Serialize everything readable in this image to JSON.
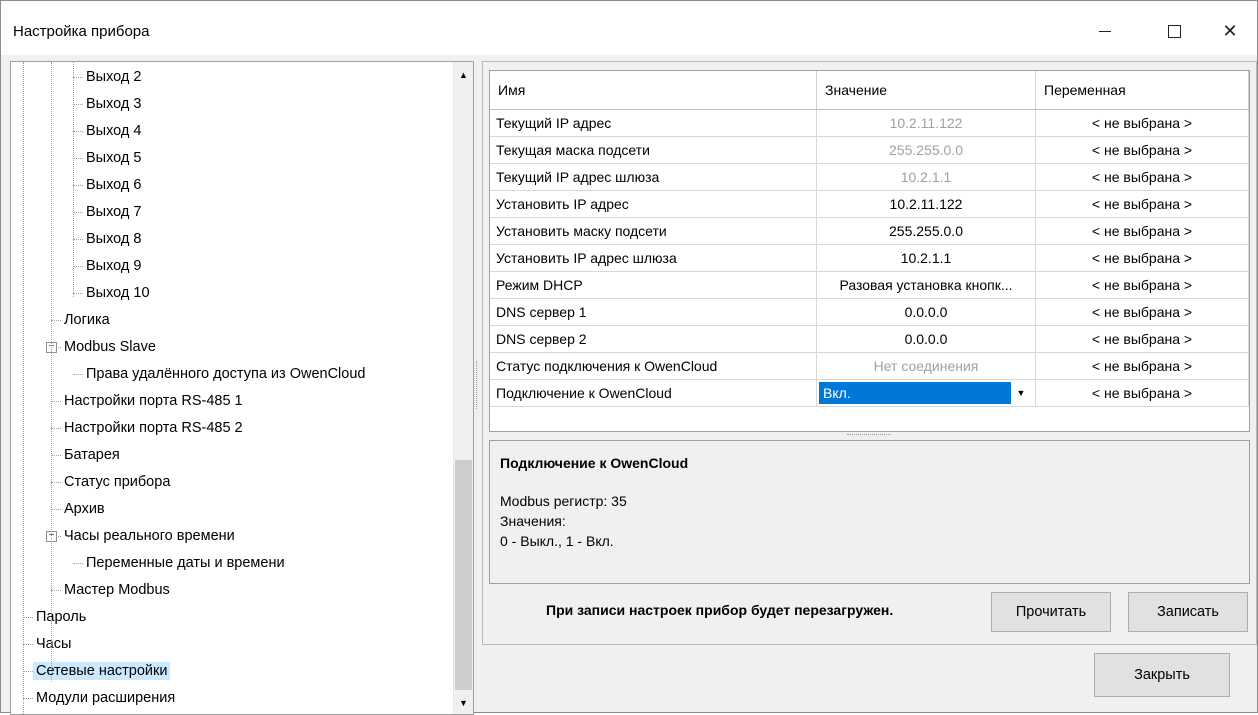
{
  "window": {
    "title": "Настройка прибора",
    "minimize_label": "—",
    "close_label": "✕"
  },
  "tree": {
    "items": [
      {
        "label": "Выход 2",
        "level": 3
      },
      {
        "label": "Выход 3",
        "level": 3
      },
      {
        "label": "Выход 4",
        "level": 3
      },
      {
        "label": "Выход 5",
        "level": 3
      },
      {
        "label": "Выход 6",
        "level": 3
      },
      {
        "label": "Выход 7",
        "level": 3
      },
      {
        "label": "Выход 8",
        "level": 3
      },
      {
        "label": "Выход 9",
        "level": 3
      },
      {
        "label": "Выход 10",
        "level": 3
      },
      {
        "label": "Логика",
        "level": 2
      },
      {
        "label": "Modbus Slave",
        "level": 2,
        "expander": "−"
      },
      {
        "label": "Права удалённого доступа из OwenCloud",
        "level": 3
      },
      {
        "label": "Настройки порта RS-485 1",
        "level": 2
      },
      {
        "label": "Настройки порта RS-485 2",
        "level": 2
      },
      {
        "label": "Батарея",
        "level": 2
      },
      {
        "label": "Статус прибора",
        "level": 2
      },
      {
        "label": "Архив",
        "level": 2
      },
      {
        "label": "Часы реального времени",
        "level": 2,
        "expander": "−"
      },
      {
        "label": "Переменные даты и времени",
        "level": 3
      },
      {
        "label": "Мастер Modbus",
        "level": 2
      },
      {
        "label": "Пароль",
        "level": 1
      },
      {
        "label": "Часы",
        "level": 1
      },
      {
        "label": "Сетевые настройки",
        "level": 1,
        "selected": true
      },
      {
        "label": "Модули расширения",
        "level": 1
      }
    ],
    "scroll_up": "▲",
    "scroll_down": "▼"
  },
  "grid": {
    "columns": [
      "Имя",
      "Значение",
      "Переменная"
    ],
    "rows": [
      {
        "name": "Текущий IP адрес",
        "value": "10.2.11.122",
        "readonly": true,
        "variable": "< не выбрана >"
      },
      {
        "name": "Текущая маска подсети",
        "value": "255.255.0.0",
        "readonly": true,
        "variable": "< не выбрана >"
      },
      {
        "name": "Текущий IP адрес шлюза",
        "value": "10.2.1.1",
        "readonly": true,
        "variable": "< не выбрана >"
      },
      {
        "name": "Установить IP адрес",
        "value": "10.2.11.122",
        "readonly": false,
        "variable": "< не выбрана >"
      },
      {
        "name": "Установить маску подсети",
        "value": "255.255.0.0",
        "readonly": false,
        "variable": "< не выбрана >"
      },
      {
        "name": "Установить IP адрес шлюза",
        "value": "10.2.1.1",
        "readonly": false,
        "variable": "< не выбрана >"
      },
      {
        "name": "Режим DHCP",
        "value": "Разовая установка кнопк...",
        "readonly": false,
        "variable": "< не выбрана >"
      },
      {
        "name": "DNS сервер 1",
        "value": "0.0.0.0",
        "readonly": false,
        "variable": "< не выбрана >"
      },
      {
        "name": "DNS сервер 2",
        "value": "0.0.0.0",
        "readonly": false,
        "variable": "< не выбрана >"
      },
      {
        "name": "Статус подключения к OwenCloud",
        "value": "Нет соединения",
        "readonly": true,
        "variable": "< не выбрана >"
      },
      {
        "name": "Подключение к OwenCloud",
        "value": "Вкл.",
        "readonly": false,
        "editing": true,
        "variable": "< не выбрана >"
      }
    ],
    "dropdown_arrow": "▼"
  },
  "description": {
    "title": "Подключение к OwenCloud",
    "line1": "Modbus регистр: 35",
    "line2": "Значения:",
    "line3": "0 - Выкл., 1 - Вкл."
  },
  "footer": {
    "note": "При записи настроек прибор будет перезагружен.",
    "read_button": "Прочитать",
    "write_button": "Записать",
    "close_button": "Закрыть"
  },
  "colors": {
    "selection": "#cce8ff",
    "accent": "#0078d7"
  }
}
